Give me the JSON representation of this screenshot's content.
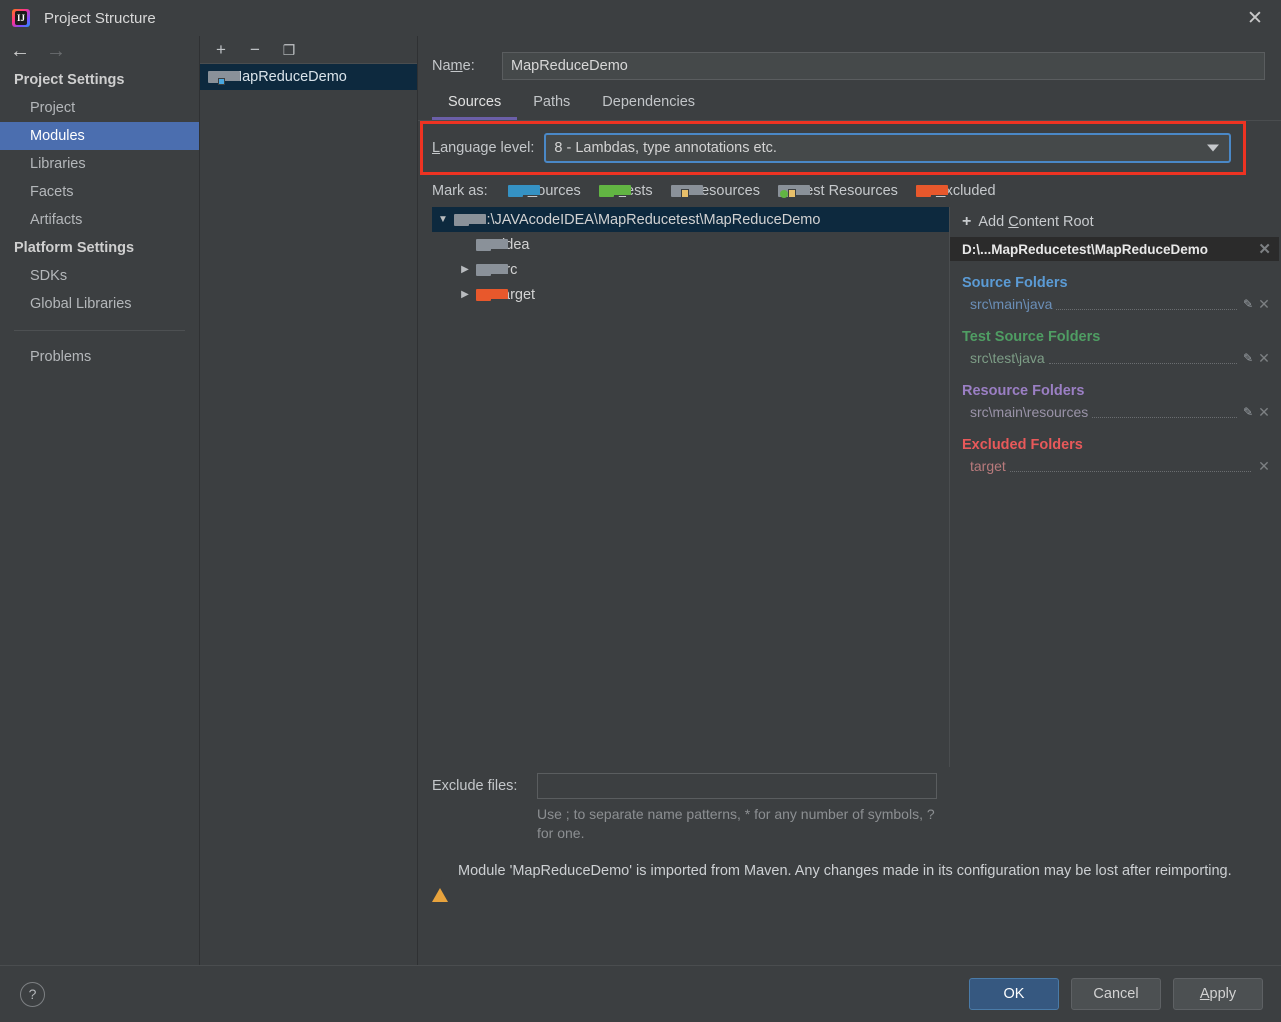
{
  "window": {
    "title": "Project Structure",
    "app_icon": "intellij-idea-icon",
    "close_label": "✕"
  },
  "sidebar": {
    "back_icon": "←",
    "forward_icon": "→",
    "groups": [
      {
        "title": "Project Settings",
        "items": [
          {
            "label": "Project",
            "selected": false
          },
          {
            "label": "Modules",
            "selected": true
          },
          {
            "label": "Libraries",
            "selected": false
          },
          {
            "label": "Facets",
            "selected": false
          },
          {
            "label": "Artifacts",
            "selected": false
          }
        ]
      },
      {
        "title": "Platform Settings",
        "items": [
          {
            "label": "SDKs",
            "selected": false
          },
          {
            "label": "Global Libraries",
            "selected": false
          }
        ]
      }
    ],
    "problems_label": "Problems"
  },
  "modules_pane": {
    "toolbar": {
      "add": "+",
      "remove": "−",
      "copy": "❐"
    },
    "items": [
      {
        "label": "MapReduceDemo",
        "selected": true
      }
    ]
  },
  "main": {
    "name_label_pre": "Na",
    "name_label_mn": "m",
    "name_label_post": "e:",
    "name_value": "MapReduceDemo",
    "tabs": [
      {
        "label": "Sources",
        "active": true
      },
      {
        "label": "Paths",
        "active": false
      },
      {
        "label": "Dependencies",
        "active": false
      }
    ],
    "language_level": {
      "label_mn": "L",
      "label_rest": "anguage level:",
      "value": "8 - Lambdas, type annotations etc.",
      "annotation_color": "#ee3322"
    },
    "mark_as": {
      "label": "Mark as:",
      "options": [
        {
          "mn": "S",
          "rest": "ources",
          "icon": "folder-blue-icon",
          "color": "#3592c4"
        },
        {
          "mn": "T",
          "rest": "ests",
          "icon": "folder-green-icon",
          "color": "#62b543"
        },
        {
          "mn": "",
          "rest": "Resources",
          "icon": "folder-resources-icon",
          "color": "#8a9199"
        },
        {
          "mn": "",
          "rest": "Test Resources",
          "icon": "folder-test-resources-icon",
          "color": "#8a9199"
        },
        {
          "mn": "E",
          "rest": "xcluded",
          "icon": "folder-orange-icon",
          "color": "#e8582c"
        }
      ]
    },
    "tree": [
      {
        "label": "D:\\JAVAcodeIDEA\\MapReducetest\\MapReduceDemo",
        "twisty": "▼",
        "indent": 0,
        "folder": "grey",
        "selected": true
      },
      {
        "label": ".idea",
        "twisty": "",
        "indent": 1,
        "folder": "grey",
        "selected": false
      },
      {
        "label": "src",
        "twisty": "▶",
        "indent": 1,
        "folder": "grey",
        "selected": false
      },
      {
        "label": "target",
        "twisty": "▶",
        "indent": 1,
        "folder": "orange",
        "selected": false
      }
    ],
    "content_roots": {
      "add_label_pre": "Add ",
      "add_label_mn": "C",
      "add_label_post": "ontent Root",
      "add_icon": "+",
      "root_path": "D:\\...MapReducetest\\MapReduceDemo",
      "root_close": "✕",
      "groups": [
        {
          "title": "Source Folders",
          "color": "#5b9bd5",
          "paths": [
            {
              "path": "src\\main\\java",
              "has_edit": true,
              "has_remove": true
            }
          ]
        },
        {
          "title": "Test Source Folders",
          "color": "#4f9d63",
          "paths": [
            {
              "path": "src\\test\\java",
              "has_edit": true,
              "has_remove": true
            }
          ]
        },
        {
          "title": "Resource Folders",
          "color": "#9b7fc4",
          "paths": [
            {
              "path": "src\\main\\resources",
              "has_edit": true,
              "has_remove": true
            }
          ]
        },
        {
          "title": "Excluded Folders",
          "color": "#e8595a",
          "paths": [
            {
              "path": "target",
              "has_edit": false,
              "has_remove": true
            }
          ]
        }
      ],
      "edit_icon": "✎",
      "remove_icon": "✕"
    },
    "exclude_files": {
      "label": "Exclude files:",
      "value": "",
      "placeholder": "",
      "hint": "Use ; to separate name patterns, * for any number of symbols, ? for one."
    },
    "warning": {
      "icon": "warning-triangle-icon",
      "text": "Module 'MapReduceDemo' is imported from Maven. Any changes made in its configuration may be lost after reimporting."
    }
  },
  "footer": {
    "help_label": "?",
    "buttons": [
      {
        "label": "OK",
        "primary": true,
        "mn": ""
      },
      {
        "label": "Cancel",
        "primary": false,
        "mn": ""
      },
      {
        "label": "Apply",
        "primary": false,
        "mn": "A"
      }
    ]
  }
}
